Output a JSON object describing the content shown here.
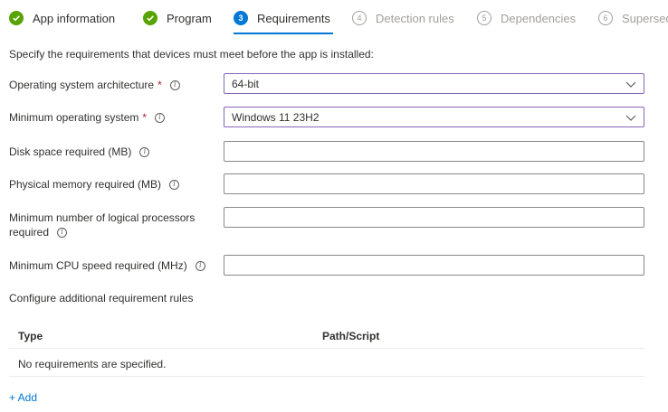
{
  "steps": [
    {
      "label": "App information",
      "state": "done"
    },
    {
      "label": "Program",
      "state": "done"
    },
    {
      "label": "Requirements",
      "number": "3",
      "state": "current"
    },
    {
      "label": "Detection rules",
      "number": "4",
      "state": "future"
    },
    {
      "label": "Dependencies",
      "number": "5",
      "state": "future"
    },
    {
      "label": "Supersedence",
      "number": "6",
      "state": "future"
    }
  ],
  "intro": "Specify the requirements that devices must meet before the app is installed:",
  "fields": {
    "os_architecture": {
      "label": "Operating system architecture",
      "required_mark": "*",
      "value": "64-bit"
    },
    "min_os": {
      "label": "Minimum operating system",
      "required_mark": "*",
      "value": "Windows 11 23H2"
    },
    "disk_space": {
      "label": "Disk space required (MB)",
      "value": ""
    },
    "physical_memory": {
      "label": "Physical memory required (MB)",
      "value": ""
    },
    "logical_processors": {
      "label_line1": "Minimum number of logical processors",
      "label_line2": "required",
      "value": ""
    },
    "cpu_speed": {
      "label": "Minimum CPU speed required (MHz)",
      "value": ""
    }
  },
  "rules": {
    "title": "Configure additional requirement rules",
    "columns": [
      "Type",
      "Path/Script"
    ],
    "empty_text": "No requirements are specified.",
    "add_label": "+ Add"
  },
  "colors": {
    "done": "#57a300",
    "current": "#0078d4",
    "future": "#a19f9d",
    "required": "#a4262c",
    "link": "#0078d4"
  }
}
